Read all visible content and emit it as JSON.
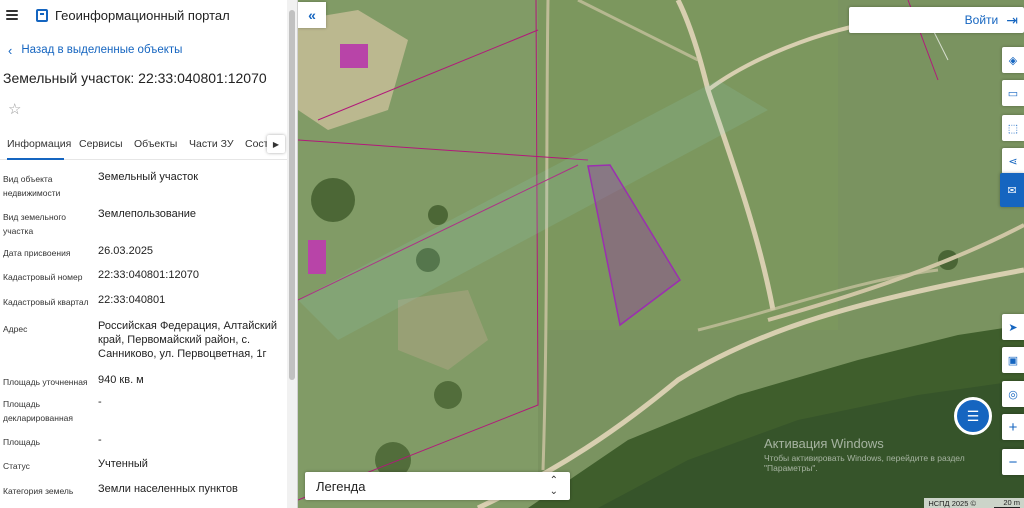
{
  "header": {
    "title": "Геоинформационный портал"
  },
  "nav": {
    "back_label": "Назад в выделенные объекты"
  },
  "object": {
    "title": "Земельный участок: 22:33:040801:12070"
  },
  "tabs": [
    "Информация",
    "Сервисы",
    "Объекты",
    "Части ЗУ",
    "Сост"
  ],
  "info_rows": [
    {
      "label": "Вид объекта недвижимости",
      "value": "Земельный участок"
    },
    {
      "label": "Вид земельного участка",
      "value": "Землепользование"
    },
    {
      "label": "Дата присвоения",
      "value": "26.03.2025"
    },
    {
      "label": "Кадастровый номер",
      "value": "22:33:040801:12070"
    },
    {
      "label": "Кадастровый квартал",
      "value": "22:33:040801"
    },
    {
      "label": "Адрес",
      "value": "Российская Федерация, Алтайский край, Первомайский район, с. Санниково, ул. Первоцветная, 1г"
    },
    {
      "label": "Площадь уточненная",
      "value": "940 кв. м"
    },
    {
      "label": "Площадь декларированная",
      "value": "-"
    },
    {
      "label": "Площадь",
      "value": "-"
    },
    {
      "label": "Статус",
      "value": "Учтенный"
    },
    {
      "label": "Категория земель",
      "value": "Земли населенных пунктов"
    }
  ],
  "map": {
    "login_label": "Войти",
    "legend_label": "Легенда",
    "watermark_title": "Активация Windows",
    "watermark_line1": "Чтобы активировать Windows, перейдите в раздел",
    "watermark_line2": "\"Параметры\".",
    "attribution": "НСПД 2025 ©",
    "scale_label": "20 m",
    "tools": [
      "layers-icon",
      "ruler-icon",
      "select-area-icon",
      "share-icon",
      "feedback-icon",
      "locate-icon",
      "picture-in-picture-icon",
      "geo-search-icon",
      "zoom-in-icon",
      "zoom-out-icon"
    ]
  },
  "colors": {
    "accent": "#1565c0",
    "parcel": "#9b2fb0"
  }
}
